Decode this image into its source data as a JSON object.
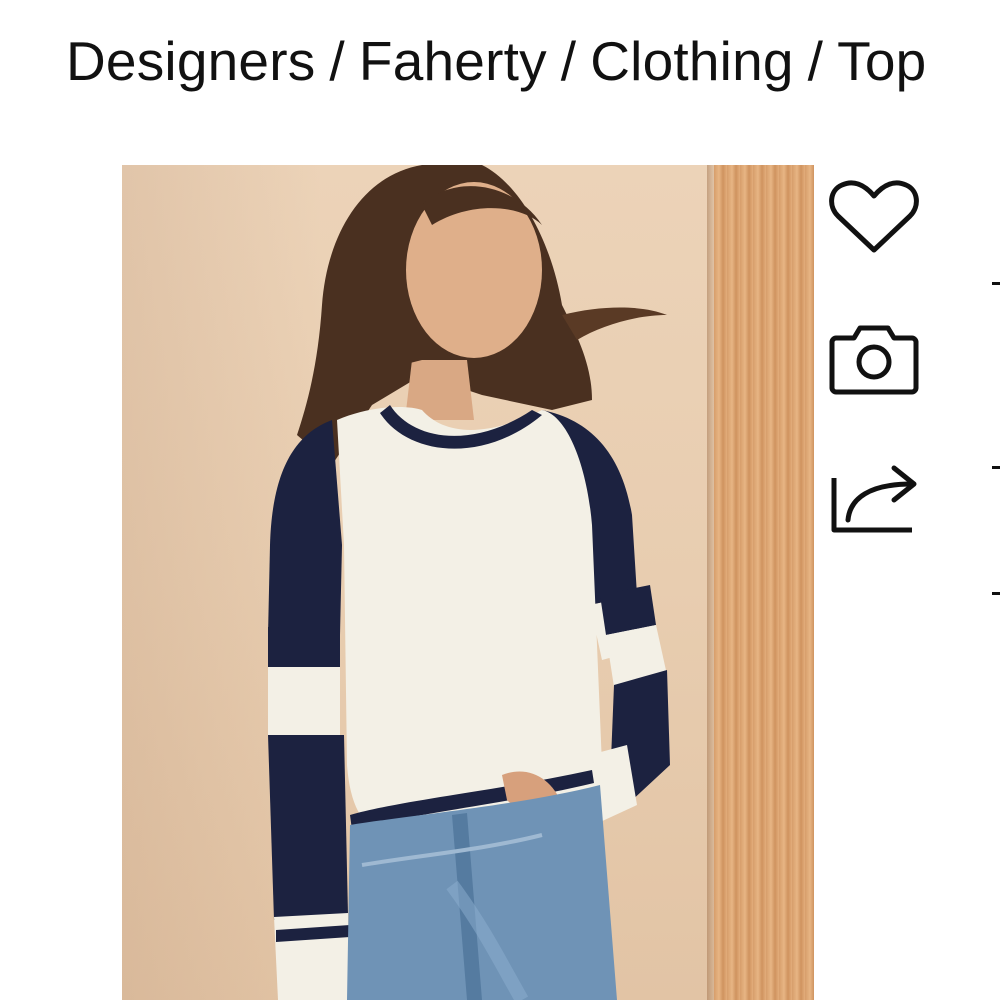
{
  "breadcrumb": {
    "items": [
      {
        "label": "Designers"
      },
      {
        "label": "Faherty"
      },
      {
        "label": "Clothing"
      },
      {
        "label": "Top"
      }
    ],
    "separator": "/"
  },
  "product": {
    "image": {
      "description_colors": {
        "background": "#ecd3b8",
        "sweater_body": "#f3f0e6",
        "sweater_navy": "#1c2240",
        "denim": "#6f93b6",
        "hair": "#4a3020",
        "wood_panel": "#dca470"
      }
    }
  },
  "actions": [
    {
      "icon": "heart-icon"
    },
    {
      "icon": "camera-icon"
    },
    {
      "icon": "share-icon"
    }
  ]
}
